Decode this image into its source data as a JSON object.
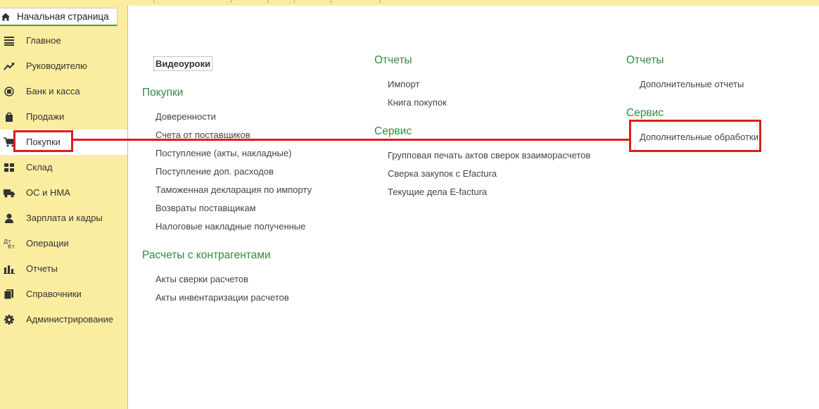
{
  "home_tab": {
    "label": "Начальная страница"
  },
  "sidebar": {
    "items": [
      {
        "label": "Главное",
        "icon": "menu-lines-icon"
      },
      {
        "label": "Руководителю",
        "icon": "trend-icon"
      },
      {
        "label": "Банк и касса",
        "icon": "bank-icon"
      },
      {
        "label": "Продажи",
        "icon": "shopping-bag-icon"
      },
      {
        "label": "Покупки",
        "icon": "cart-icon",
        "active": true
      },
      {
        "label": "Склад",
        "icon": "warehouse-icon"
      },
      {
        "label": "ОС и НМА",
        "icon": "truck-icon"
      },
      {
        "label": "Зарплата и кадры",
        "icon": "person-icon"
      },
      {
        "label": "Операции",
        "icon": "operations-icon"
      },
      {
        "label": "Отчеты",
        "icon": "bar-chart-icon"
      },
      {
        "label": "Справочники",
        "icon": "books-icon"
      },
      {
        "label": "Администрирование",
        "icon": "gear-icon"
      }
    ]
  },
  "content": {
    "col1": {
      "video_lessons": "Видеоуроки",
      "purchases_title": "Покупки",
      "purchases_links": [
        "Доверенности",
        "Счета от поставщиков",
        "Поступление (акты, накладные)",
        "Поступление доп. расходов",
        "Таможенная декларация по импорту",
        "Возвраты поставщикам",
        "Налоговые накладные полученные"
      ],
      "settlements_title": "Расчеты с контрагентами",
      "settlements_links": [
        "Акты сверки расчетов",
        "Акты инвентаризации расчетов"
      ]
    },
    "col2": {
      "reports_title": "Отчеты",
      "reports_links": [
        "Импорт",
        "Книга покупок"
      ],
      "service_title": "Сервис",
      "service_links": [
        "Групповая печать актов сверок взаиморасчетов",
        "Сверка закупок с Efactura",
        "Текущие дела E-factura"
      ]
    },
    "col3": {
      "reports_title": "Отчеты",
      "reports_links": [
        "Дополнительные отчеты"
      ],
      "service_title": "Сервис",
      "service_links": [
        "Дополнительные обработки"
      ]
    }
  },
  "colors": {
    "sidebar_bg": "#fbeda0",
    "section_heading": "#2e8b3e",
    "annotation": "#e01c1c"
  }
}
